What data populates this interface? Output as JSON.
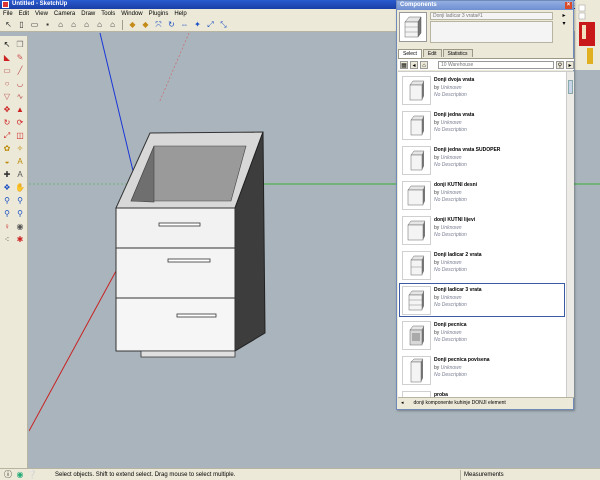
{
  "window": {
    "title": "Untitled - SketchUp"
  },
  "menu": [
    "File",
    "Edit",
    "View",
    "Camera",
    "Draw",
    "Tools",
    "Window",
    "Plugins",
    "Help"
  ],
  "toolbar": {
    "buttons": [
      "select-arrow-icon",
      "new-file-icon",
      "open-folder-icon",
      "save-icon",
      "house-icon",
      "front-view-icon",
      "right-view-icon",
      "back-view-icon",
      "left-view-icon",
      "move-axes-icon",
      "scale-axes-icon",
      "rotate-icon",
      "component-icon",
      "flip-icon",
      "solid-icon",
      "section-icon",
      "zoom-window-icon"
    ]
  },
  "palette": {
    "tools": [
      "select-icon",
      "component-icon",
      "paint-icon",
      "eraser-icon",
      "rectangle-icon",
      "line-icon",
      "circle-icon",
      "arc-icon",
      "polygon-icon",
      "freehand-icon",
      "move-icon",
      "pushpull-icon",
      "rotate-icon",
      "followme-icon",
      "scale-icon",
      "offset-icon",
      "tape-icon",
      "dimension-icon",
      "protractor-icon",
      "text-icon",
      "axes-icon",
      "3dtext-icon",
      "orbit-icon",
      "pan-icon",
      "zoom-icon",
      "zoom-window-icon",
      "zoom-extents-icon",
      "previous-icon",
      "position-camera-icon",
      "walk-icon",
      "footprints-icon",
      "look-around-icon"
    ]
  },
  "components": {
    "title": "Components",
    "selected_name": "Donji ladicar 3 vrata#1",
    "tabs": [
      "Select",
      "Edit",
      "Statistics"
    ],
    "active_tab": "Select",
    "search_value": "10 Warehouse",
    "items": [
      {
        "name": "Donji dvoja vrata",
        "by": "by",
        "author": "Unknown",
        "description": "No Description"
      },
      {
        "name": "Donji jedna vrata",
        "by": "by",
        "author": "Unknown",
        "description": "No Description"
      },
      {
        "name": "Donji jedna vrata SUDOPER",
        "by": "by",
        "author": "Unknown",
        "description": "No Description"
      },
      {
        "name": "donji KUTNI desni",
        "by": "by",
        "author": "Unknown",
        "description": "No Description"
      },
      {
        "name": "donji KUTNI lijevi",
        "by": "by",
        "author": "Unknown",
        "description": "No Description"
      },
      {
        "name": "Donji ladicar 2 vrata",
        "by": "by",
        "author": "Unknown",
        "description": "No Description"
      },
      {
        "name": "Donji ladicar 3 vrata",
        "by": "by",
        "author": "Unknown",
        "description": "No Description"
      },
      {
        "name": "Donji pecnica",
        "by": "by",
        "author": "Unknown",
        "description": "No Description"
      },
      {
        "name": "Donji pecnica povisena",
        "by": "by",
        "author": "Unknown",
        "description": "No Description"
      },
      {
        "name": "proba",
        "by": "",
        "author": "",
        "description": ""
      }
    ],
    "selected_index": 6,
    "status": "donji komponente kuhinje DONJI element"
  },
  "statusbar": {
    "message": "Select objects. Shift to extend select. Drag mouse to select multiple.",
    "measurements_label": "Measurements"
  }
}
